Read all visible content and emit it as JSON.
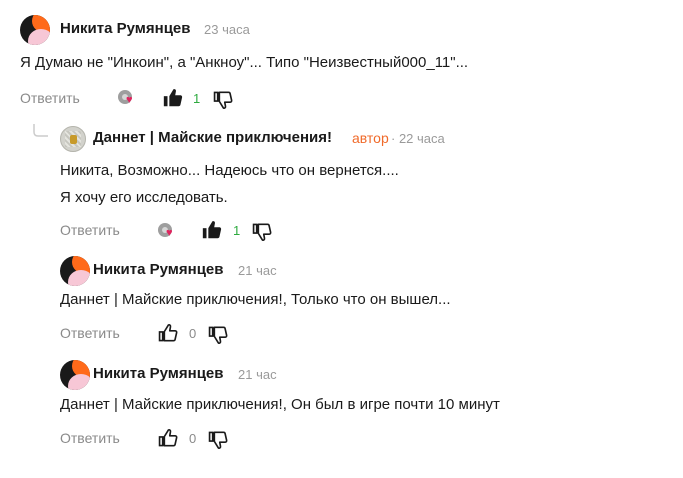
{
  "comments": [
    {
      "author": "Никита Румянцев",
      "time": "23 часа",
      "lines": [
        "Я Думаю не \"Инкоин\", а \"Анкноу\"... Типо \"Неизвестный000_11\"..."
      ],
      "reply_label": "Ответить",
      "like_count": "1"
    },
    {
      "author": "Даннет | Майские приключения!",
      "author_badge": "автор",
      "time": "· 22 часа",
      "lines": [
        "Никита, Возможно... Надеюсь что он вернется....",
        "Я хочу его исследовать."
      ],
      "reply_label": "Ответить",
      "like_count": "1"
    },
    {
      "author": "Никита Румянцев",
      "time": "21 час",
      "lines": [
        "Даннет | Майские приключения!, Только что он вышел..."
      ],
      "reply_label": "Ответить",
      "like_count": "0"
    },
    {
      "author": "Никита Румянцев",
      "time": "21 час",
      "lines": [
        "Даннет | Майские приключения!, Он был в игре почти 10 минут"
      ],
      "reply_label": "Ответить",
      "like_count": "0"
    }
  ],
  "icons": {
    "like": "thumbs-up-icon",
    "dislike": "thumbs-down-icon",
    "reactions": "reaction-avatars-icon"
  },
  "colors": {
    "accent_author": "#f06a2a",
    "like_count_active": "#2eaa3f"
  }
}
